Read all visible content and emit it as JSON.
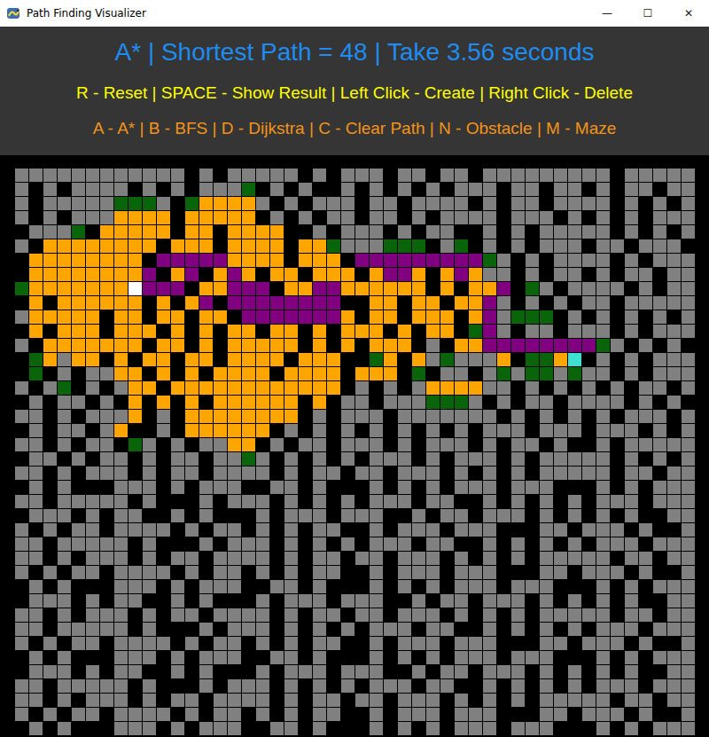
{
  "window": {
    "title": "Path Finding Visualizer",
    "controls": [
      "—",
      "☐",
      "✕"
    ]
  },
  "header": {
    "title": "A* | Shortest Path = 48 | Take 3.56 seconds",
    "help": [
      "R - Reset | SPACE - Show Result | Left Click - Create | Right Click - Delete",
      "A - A* | B - BFS | D - Dijkstra | C - Clear Path | N - Obstacle | M - Maze"
    ]
  },
  "grid": {
    "rows": [
      "............#.#.....#.#...#..#..#.........#.....",
      ".#.#....#.#.#...g#.#.##.#.#.#.#...#..#..#.#..#..",
      ".#.....ggg.#goooo.#.#...#..#....#.#..#....#.#.#.",
      ".#.#...oooo#ooooo#.#.#..#..#.#....#...#.#.#.#...",
      "#...g#ooooo#oo#oooo##.#...#.#..##.#.#.....#.#.#.",
      ".#oooooooo#ooo#oooo#oog...ggg#.g#.#.#...#..#...#",
      "#oooooooo#pppppoooo#ooo#pppppppppg.#.#....#.#...",
      "#oooooooop#op#opo#oo#ooo#oppo#opo..#.#..#.#..#..",
      "goooooooSppp#ooppp#ooppoooooo#o#oop#g.#....#.#...",
      "#o#oooooo#o#op#pppppppp##oo#oo#oop.#.#.#..#.....",
      ".ooooo#oo#oo#oo#pppppppo#oo#ooo#op.ggg#.#.#.#.#.",
      "#o#ooo#ooo#o#o#oo#oo#o#ooo#o#oo#gp.#..#...#.#...",
      ".#ooooooo#oo#o#ooooo#o#o#ooo#.#ooppppppppg.#.#.#.",
      "#go.oo#o#oo#oo#oooo#ooo##go#o.g...o#ggoE#.#.#...",
      "#g#.#..oo#o#o#oooo#oooo#ooo#g#..#.g.gg.g..#.#...",
      ".#.g#.#.oo#oooooooooooo#.#.#.oooo..#.#.#.#.#..#..",
      "#.#..#.#o#o#o#oooooo#o#..#...ggg.#.#..#....#.#.#.",
      "..#.#...o#.#oooooooo#.#...#.......#.#.#.#.#...#...",
      "#.#..#.o##.#oooooo#.#.#.#.#.#.#.#...#...#...#.#.#.",
      "..#.#..#g.#.#..oo#.#..#...#.#...#.#..#.##.#.....",
      "#..#.#..#.#..#..g.#.#.#.#...#.#...#.#.....#.#.#.",
      "..#.#...#.#..#....#.#..#..#...#.#.#.#.....#..#..",
      "#.#.###...#.#...##..#.###.#.#.#...#...###.#.#...",
      "..#.....#.###.#...#.#.#.#...#..##.#.#.#.#...#...#.",
      "#...#.#..##.#.###.#...#...##.#..#...#.#.#.#.##..",
      ".#.#..#....#.#..#.#.#..##.#...#...###..#...#.##",
      "..#.....#.###.#...#.#.#.#...#..##.#.#.#.#...#...#.",
      "..#.#...#.#..#....#.#..#..#...#.#.#.#.....#..#..",
      ".#.#..#....#.#..#.#.#..##.#...#...###..#...#.##",
      "#.#.###...#.#...##..#.###.#.#.#...#...###.#.#...",
      "#...#.#..##.#.###.#...#...##.#..#...#.#.#.#.##..",
      "..#.#...#.#..#....#.#..#..#...#.#.#.#.....#..#..",
      "..#.....#.###.#...#.#.#.#...#..##.#.#.#.#...#...#.",
      ".#.#..#....#.#..#.#.#..##.#...#...###..#...#.##",
      "#.#.###...#.#...##..#.###.#.#.#...#...###.#.#...",
      "#...#.#..##.#.###.#...#...##.#..#...#.#.#.#.##..",
      "..#.....#.###.#...#.#.#.#...#..##.#.#.#.#...#...#.",
      "..#.#...#.#..#....#.#..#..#...#.#.#.#.....#..#..",
      ".#.#..#....#.#..#.#.#..##.#...#...###..#...#.##",
      "#.#.###...#.#...##..#.###.#.#.#...#...###.#.#..."
    ]
  }
}
